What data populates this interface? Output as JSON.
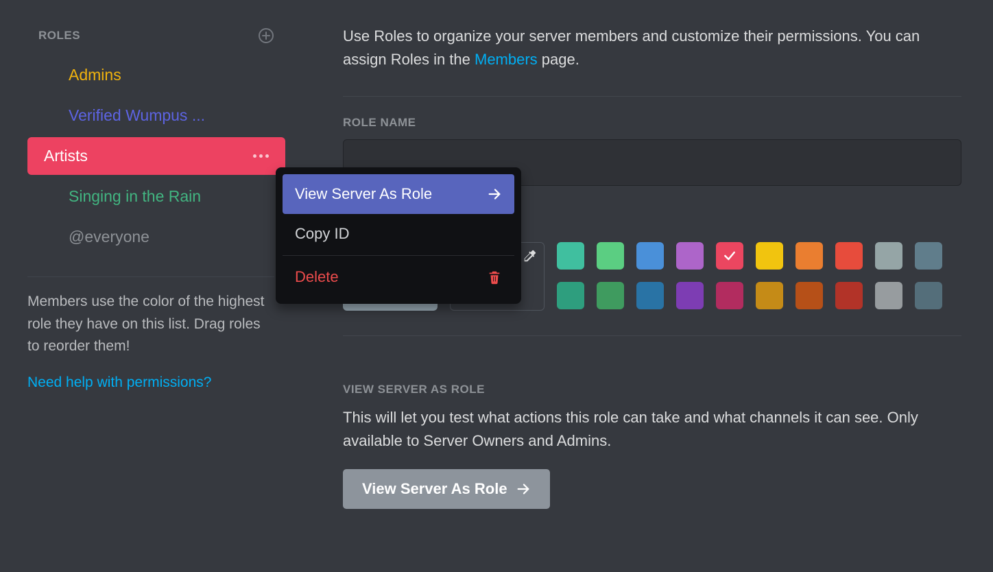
{
  "sidebar": {
    "title": "ROLES",
    "roles": [
      {
        "label": "Admins",
        "color": "#f2b40e"
      },
      {
        "label": "Verified Wumpus ...",
        "color": "#5d64e3"
      },
      {
        "label": "Artists",
        "color": "#ffffff",
        "selected": true
      },
      {
        "label": "Singing in the Rain",
        "color": "#42b581"
      },
      {
        "label": "@everyone",
        "color": "#8e9297"
      }
    ],
    "note": "Members use the color of the highest role they have on this list. Drag roles to reorder them!",
    "help": "Need help with permissions?"
  },
  "main": {
    "intro_prefix": "Use Roles to organize your server members and customize their permissions. You can assign Roles in the ",
    "intro_link": "Members",
    "intro_suffix": " page.",
    "role_name_label": "ROLE NAME",
    "role_name_value": "",
    "colors_row1": [
      "#40bf9f",
      "#5bce82",
      "#4a90d9",
      "#ad65c9",
      "#eb4660",
      "#f1c40f",
      "#ea7e30",
      "#e74c3c",
      "#95a5a6",
      "#607d8b"
    ],
    "colors_row2": [
      "#2e9e7e",
      "#3f9b5f",
      "#2973a5",
      "#7d3db3",
      "#b22c5f",
      "#c58b17",
      "#b65018",
      "#b23328",
      "#979c9f",
      "#546e7a"
    ],
    "selected_color_index": 4,
    "view_section_label": "VIEW SERVER AS ROLE",
    "view_desc": "This will let you test what actions this role can take and what channels it can see. Only available to Server Owners and Admins.",
    "view_button": "View Server As Role"
  },
  "menu": {
    "view_as_role": "View Server As Role",
    "copy_id": "Copy ID",
    "delete": "Delete"
  }
}
